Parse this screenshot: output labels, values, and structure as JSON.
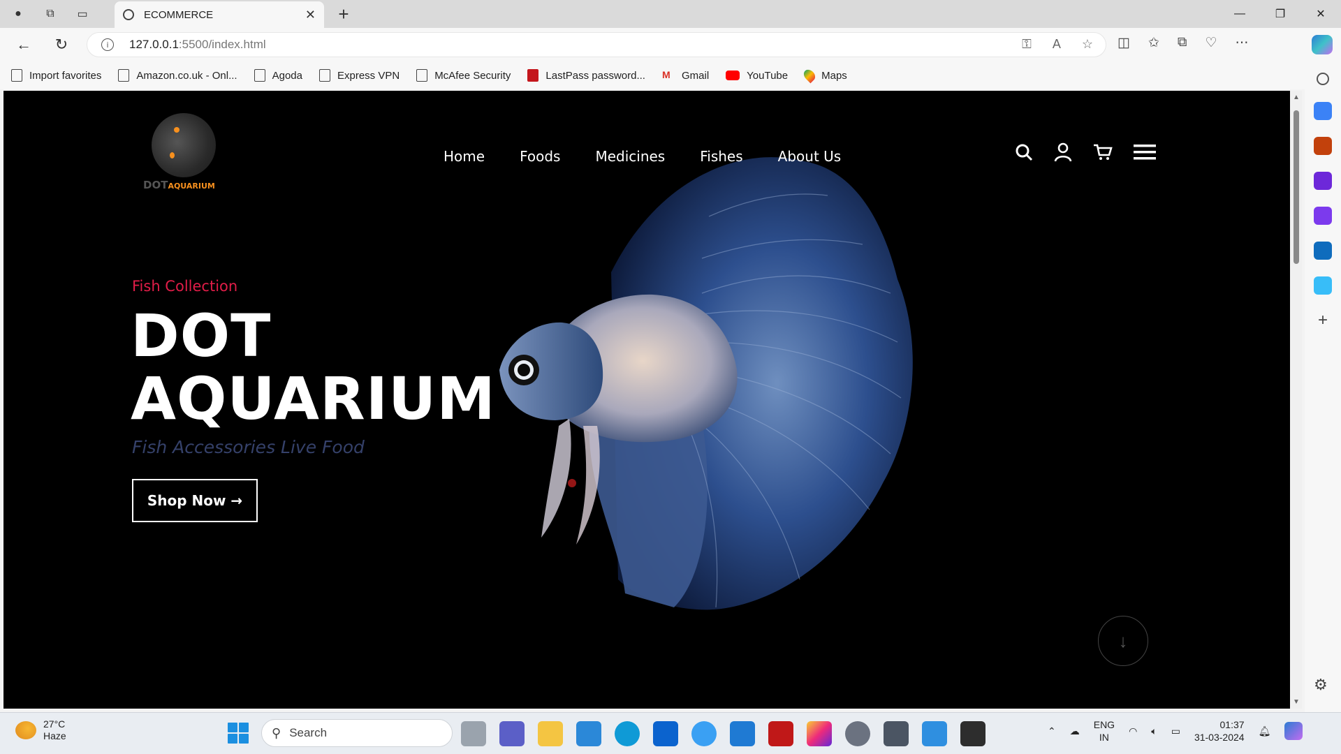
{
  "browser": {
    "tab_title": "ECOMMERCE",
    "url_host": "127.0.0.1",
    "url_path": ":5500/index.html",
    "bookmarks": [
      {
        "label": "Import favorites",
        "icon": "import-icon"
      },
      {
        "label": "Amazon.co.uk - Onl...",
        "icon": "page-icon"
      },
      {
        "label": "Agoda",
        "icon": "page-icon"
      },
      {
        "label": "Express VPN",
        "icon": "page-icon"
      },
      {
        "label": "McAfee Security",
        "icon": "page-icon"
      },
      {
        "label": "LastPass password...",
        "icon": "lastpass-icon"
      },
      {
        "label": "Gmail",
        "icon": "gmail-icon"
      },
      {
        "label": "YouTube",
        "icon": "youtube-icon"
      },
      {
        "label": "Maps",
        "icon": "maps-icon"
      }
    ]
  },
  "site": {
    "logo_word1": "DOT",
    "logo_word2": "AQUARIUM",
    "nav": [
      "Home",
      "Foods",
      "Medicines",
      "Fishes",
      "About Us"
    ],
    "hero": {
      "subtitle": "Fish Collection",
      "title_line1": "DOT",
      "title_line2": "AQUARIUM",
      "tagline": "Fish Accessories Live Food",
      "cta": "Shop Now →"
    },
    "colors": {
      "accent": "#e11d48",
      "logo_orange": "#f7901e",
      "background": "#000000"
    }
  },
  "taskbar": {
    "temperature": "27°C",
    "weather": "Haze",
    "search_placeholder": "Search",
    "lang_line1": "ENG",
    "lang_line2": "IN",
    "time": "01:37",
    "date": "31-03-2024"
  }
}
